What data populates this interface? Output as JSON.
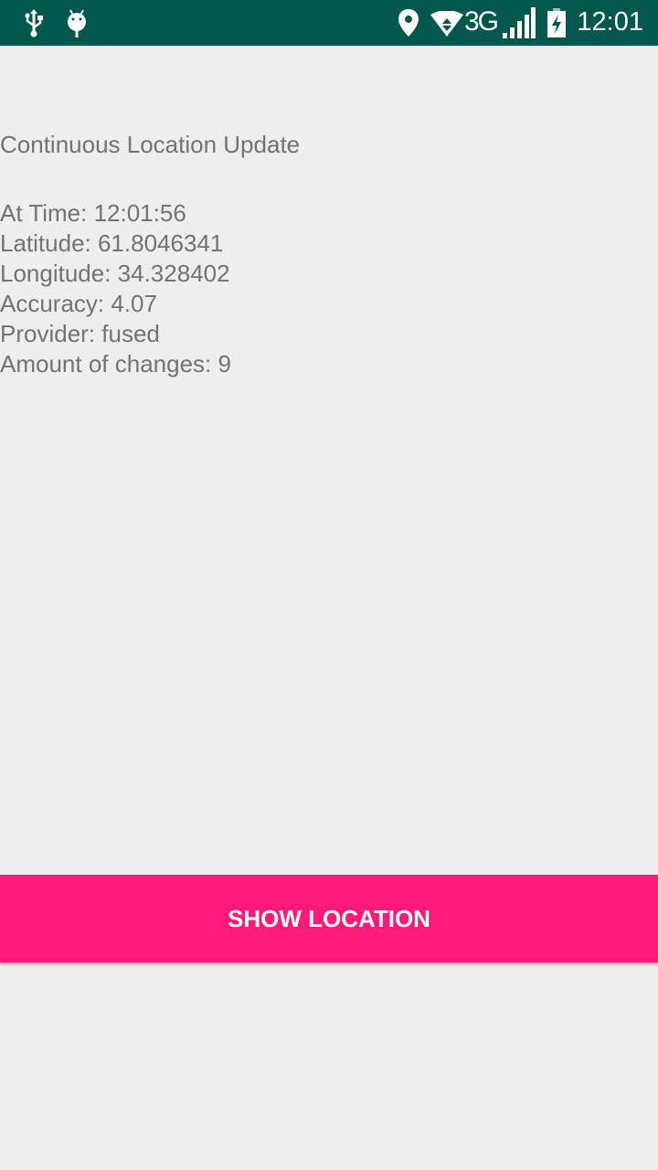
{
  "status_bar": {
    "time": "12:01",
    "network": "3G",
    "icons": [
      "usb-icon",
      "android-debug-icon",
      "location-pin-icon",
      "wifi-icon",
      "signal-icon",
      "battery-charging-icon"
    ]
  },
  "main": {
    "title": "Continuous Location Update",
    "lines": [
      "At Time: 12:01:56",
      "Latitude: 61.8046341",
      "Longitude: 34.328402",
      "Accuracy: 4.07",
      "Provider: fused",
      "Amount of changes: 9"
    ]
  },
  "button": {
    "label": "SHOW LOCATION"
  },
  "colors": {
    "status_bar": "#00574b",
    "accent": "#ff1a79",
    "background": "#eeeeee",
    "text": "#737373"
  }
}
